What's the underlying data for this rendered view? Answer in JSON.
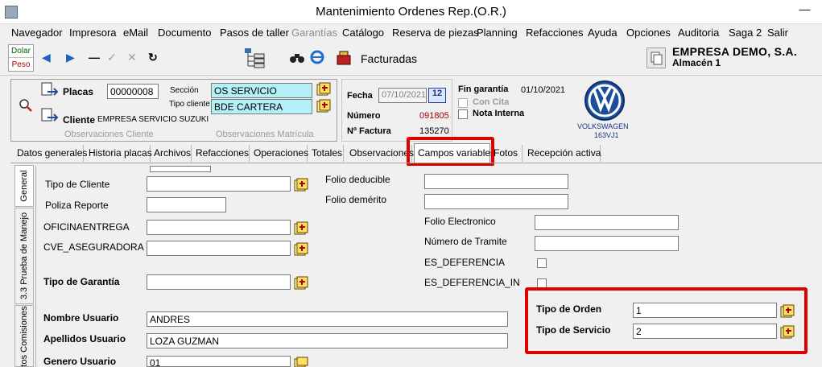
{
  "window": {
    "title": "Mantenimiento Ordenes Rep.(O.R.)",
    "minimize_glyph": "—"
  },
  "menu": [
    {
      "label": "Navegador",
      "enabled": true
    },
    {
      "label": "Impresora",
      "enabled": true
    },
    {
      "label": "eMail",
      "enabled": true
    },
    {
      "label": "Documento",
      "enabled": true
    },
    {
      "label": "Pasos de taller",
      "enabled": true
    },
    {
      "label": "Garantías",
      "enabled": false
    },
    {
      "label": "Catálogo",
      "enabled": true
    },
    {
      "label": "Reserva de piezas",
      "enabled": true
    },
    {
      "label": "Planning",
      "enabled": true
    },
    {
      "label": "Refacciones",
      "enabled": true
    },
    {
      "label": "Ayuda",
      "enabled": true
    },
    {
      "label": "Opciones",
      "enabled": true
    },
    {
      "label": "Auditoria",
      "enabled": true
    },
    {
      "label": "Saga 2",
      "enabled": true
    },
    {
      "label": "Salir",
      "enabled": true
    }
  ],
  "toolbar": {
    "currency_top": "Dolar",
    "currency_bottom": "Peso",
    "icons": [
      "arrow-left-icon",
      "arrow-right-icon",
      "minus-icon",
      "check-icon",
      "x-icon",
      "redo-icon"
    ],
    "status": "Facturadas",
    "company": "EMPRESA DEMO, S.A.",
    "warehouse": "Almacén 1"
  },
  "header": {
    "placas_label": "Placas",
    "placas_value": "00000008",
    "seccion_label": "Sección",
    "seccion_value": "OS SERVICIO",
    "tipo_cliente_label": "Tipo cliente",
    "tipo_cliente_value": "BDE CARTERA",
    "cliente_label": "Cliente",
    "cliente_value": "EMPRESA SERVICIO SUZUKI",
    "obs_cliente": "Observaciones  Cliente",
    "obs_matricula": "Observaciones  Matrícula",
    "fecha_label": "Fecha",
    "fecha_value": "07/10/2021",
    "cal_label": "12",
    "numero_label": "Número",
    "numero_value": "091805",
    "factura_label": "Nº Factura",
    "factura_value": "135270",
    "fin_garantia_label": "Fin garantía",
    "fin_garantia_value": "01/10/2021",
    "con_cita_label": "Con Cita",
    "nota_interna_label": "Nota Interna",
    "brand": "VOLKSWAGEN",
    "brand_code": "163VJ1",
    "colors": {
      "cyan_field": "#b4f0f8",
      "numero_red": "#a00000",
      "highlight": "#e00000"
    }
  },
  "tabs": [
    {
      "label": "Datos generales"
    },
    {
      "label": "Historia placas"
    },
    {
      "label": "Archivos"
    },
    {
      "label": "Refacciones"
    },
    {
      "label": "Operaciones"
    },
    {
      "label": "Totales"
    },
    {
      "label": "Observaciones"
    },
    {
      "label": "Campos variables",
      "active": true
    },
    {
      "label": "Fotos"
    },
    {
      "label": "Recepción activa"
    }
  ],
  "vtabs": [
    {
      "label": "General",
      "active": true
    },
    {
      "label": "3.3 Prueba de Manejo"
    },
    {
      "label": "tos Comisiones"
    }
  ],
  "fields": {
    "tipo_cliente_label": "Tipo de Cliente",
    "poliza_label": "Poliza Reporte",
    "oficina_label": "OFICINAENTREGA",
    "cve_label": "CVE_ASEGURADORA",
    "garantia_label": "Tipo de Garantía",
    "nombre_label": "Nombre Usuario",
    "nombre_value": "ANDRES",
    "apellidos_label": "Apellidos Usuario",
    "apellidos_value": "LOZA GUZMAN",
    "genero_label": "Genero Usuario",
    "genero_value": "01",
    "folio_deducible_label": "Folio deducible",
    "folio_demerito_label": "Folio demérito",
    "folio_electronico_label": "Folio Electronico",
    "numero_tramite_label": "Número de Tramite",
    "es_deferencia_label": "ES_DEFERENCIA",
    "es_deferencia_in_label": "ES_DEFERENCIA_IN",
    "tipo_orden_label": "Tipo de Orden",
    "tipo_orden_value": "1",
    "tipo_servicio_label": "Tipo de Servicio",
    "tipo_servicio_value": "2"
  }
}
